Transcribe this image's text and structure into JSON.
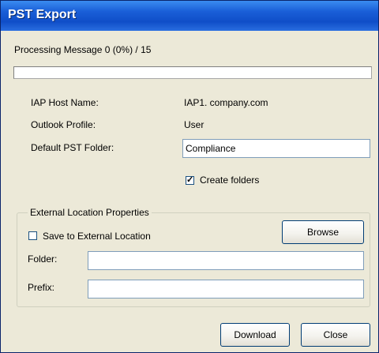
{
  "window": {
    "title": "PST Export"
  },
  "progress": {
    "status_text": "Processing Message 0 (0%) / 15",
    "percent": 0
  },
  "fields": {
    "host_label": "IAP Host Name:",
    "host_value": "IAP1. company.com",
    "profile_label": "Outlook Profile:",
    "profile_value": "User",
    "pst_folder_label": "Default PST Folder:",
    "pst_folder_value": "Compliance"
  },
  "create_folders": {
    "label": "Create folders",
    "checked": true
  },
  "external": {
    "group_title": "External Location Properties",
    "save_label": "Save to External Location",
    "save_checked": false,
    "browse_label": "Browse",
    "folder_label": "Folder:",
    "folder_value": "",
    "prefix_label": "Prefix:",
    "prefix_value": ""
  },
  "buttons": {
    "download_label": "Download",
    "close_label": "Close"
  }
}
